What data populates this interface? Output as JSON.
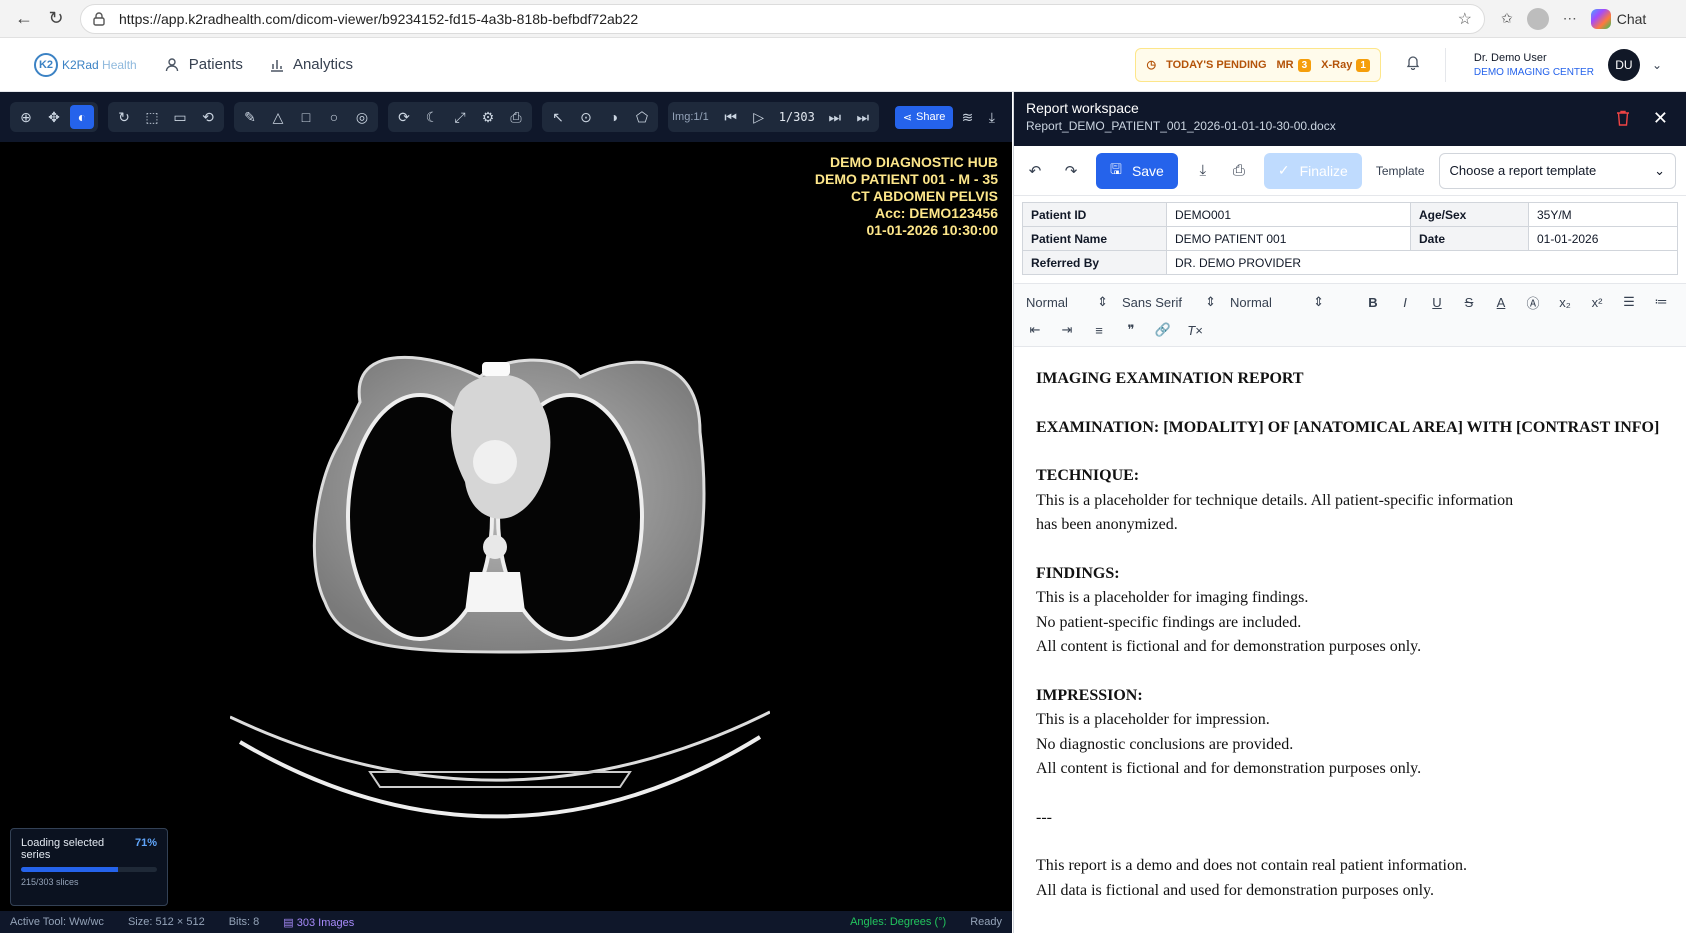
{
  "browser": {
    "url": "https://app.k2radhealth.com/dicom-viewer/b9234152-fd15-4a3b-818b-befbdf72ab22",
    "chat_label": "Chat"
  },
  "header": {
    "logo_text_a": "K2Rad",
    "logo_text_b": " Health",
    "logo_mark": "K2",
    "nav": [
      {
        "label": "Patients",
        "icon": "user-icon"
      },
      {
        "label": "Analytics",
        "icon": "bar-chart-icon"
      }
    ],
    "pending": {
      "label": "TODAY'S PENDING",
      "mr_label": "MR",
      "mr_count": "3",
      "xray_label": "X-Ray",
      "xray_count": "1"
    },
    "user_name": "Dr. Demo User",
    "user_center": "DEMO IMAGING CENTER",
    "initials": "DU"
  },
  "viewer": {
    "img_label": "Img:1/1",
    "slice": "1/303",
    "share_label": "Share",
    "overlay": [
      "DEMO DIAGNOSTIC HUB",
      "DEMO PATIENT 001 - M - 35",
      "CT ABDOMEN PELVIS",
      "Acc: DEMO123456",
      "01-01-2026 10:30:00"
    ],
    "loading": {
      "title_a": "Loading selected",
      "title_b": "series",
      "percent": "71%",
      "progress": 0.71,
      "slices": "215/303 slices"
    },
    "status": {
      "active_tool": "Active Tool: Ww/wc",
      "size": "Size: 512 × 512",
      "bits": "Bits: 8",
      "images": "303 Images",
      "angles": "Angles: Degrees (°)",
      "ready": "Ready"
    }
  },
  "report": {
    "title": "Report workspace",
    "filename": "Report_DEMO_PATIENT_001_2026-01-01-10-30-00.docx",
    "save_label": "Save",
    "finalize_label": "Finalize",
    "template_label": "Template",
    "template_value": "Choose a report template",
    "patient": {
      "id_label": "Patient ID",
      "id": "DEMO001",
      "age_label": "Age/Sex",
      "age": "35Y/M",
      "name_label": "Patient Name",
      "name": "DEMO PATIENT 001",
      "date_label": "Date",
      "date": "01-01-2026",
      "ref_label": "Referred By",
      "ref": "DR. DEMO PROVIDER"
    },
    "editor_toolbar": {
      "heading": "Normal",
      "font": "Sans Serif",
      "size": "Normal"
    },
    "content": {
      "title": "IMAGING EXAMINATION REPORT",
      "exam": "EXAMINATION: [MODALITY] OF [ANATOMICAL AREA] WITH [CONTRAST INFO]",
      "technique_h": "TECHNIQUE:",
      "technique_1": "This is a placeholder for technique details. All patient-specific information",
      "technique_2": "has been anonymized.",
      "findings_h": "FINDINGS:",
      "findings_1": "This is a placeholder for imaging findings.",
      "findings_2": "No patient-specific findings are included.",
      "findings_3": "All content is fictional and for demonstration purposes only.",
      "impression_h": "IMPRESSION:",
      "impression_1": "This is a placeholder for impression.",
      "impression_2": "No diagnostic conclusions are provided.",
      "impression_3": "All content is fictional and for demonstration purposes only.",
      "divider": "---",
      "footer_1": "This report is a demo and does not contain real patient information.",
      "footer_2": "All data is fictional and used for demonstration purposes only."
    }
  }
}
